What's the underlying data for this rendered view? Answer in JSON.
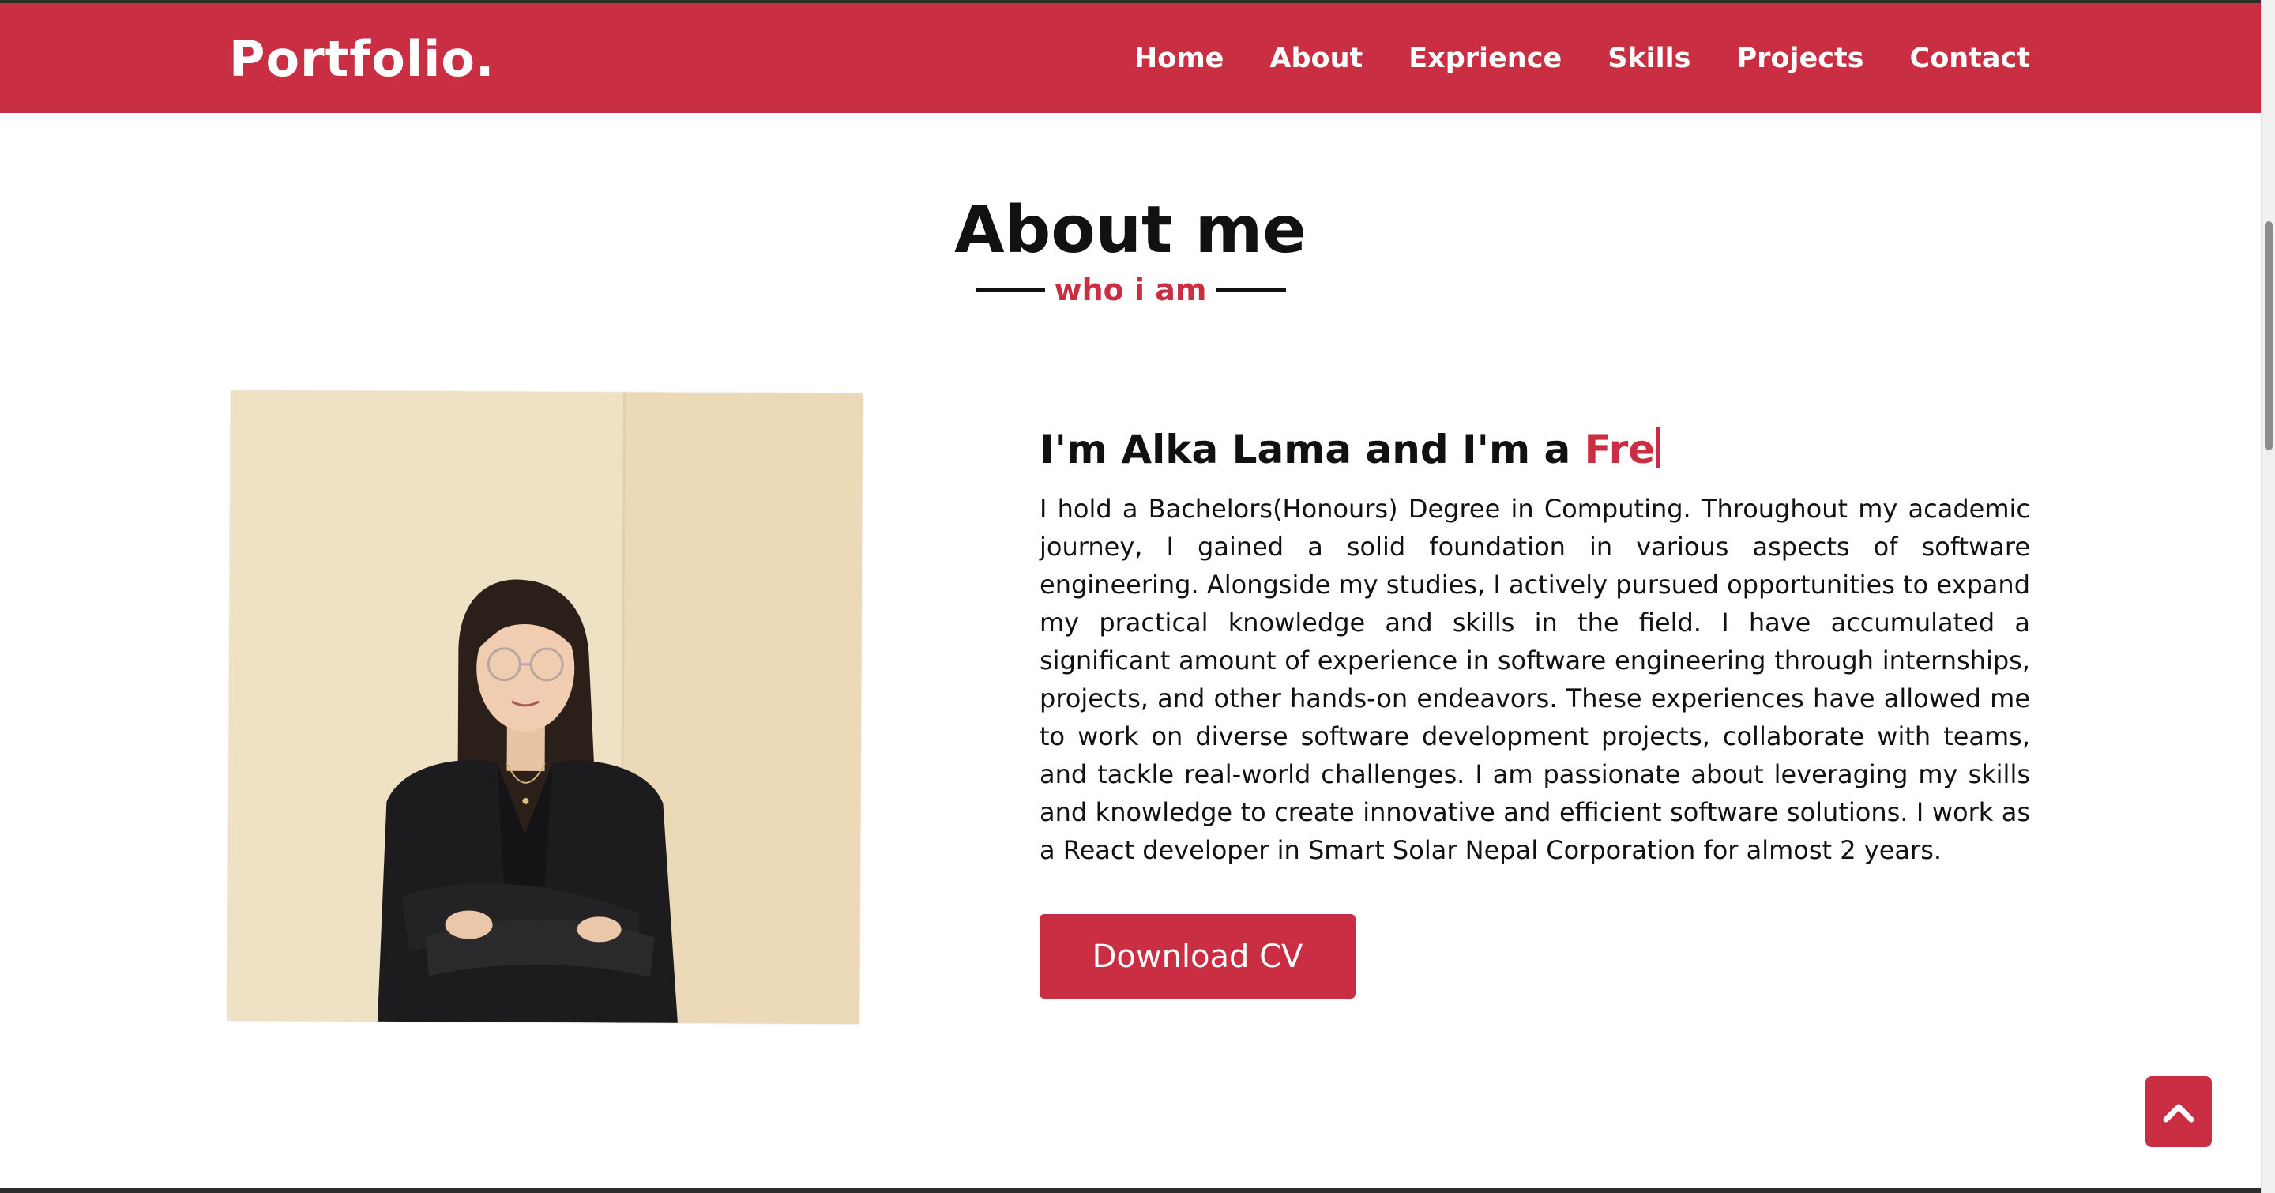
{
  "colors": {
    "accent": "#c92e42",
    "text": "#111111",
    "background": "#ffffff"
  },
  "navbar": {
    "brand": "Portfolio.",
    "links": [
      {
        "label": "Home"
      },
      {
        "label": "About"
      },
      {
        "label": "Exprience"
      },
      {
        "label": "Skills"
      },
      {
        "label": "Projects"
      },
      {
        "label": "Contact"
      }
    ]
  },
  "about": {
    "title": "About me",
    "subtitle": "who i am",
    "intro_prefix": "I'm Alka Lama and I'm a ",
    "intro_typed": "Fre",
    "bio": "I hold a Bachelors(Honours) Degree in Computing. Throughout my academic journey, I gained a solid foundation in various aspects of software engineering. Alongside my studies, I actively pursued opportunities to expand my practical knowledge and skills in the field. I have accumulated a significant amount of experience in software engineering through internships, projects, and other hands-on endeavors. These experiences have allowed me to work on diverse software development projects, collaborate with teams, and tackle real-world challenges. I am passionate about leveraging my skills and knowledge to create innovative and efficient software solutions. I work as a React developer in Smart Solar Nepal Corporation for almost 2 years.",
    "download_label": "Download CV"
  },
  "icons": {
    "scroll_top": "chevron-up-icon"
  }
}
